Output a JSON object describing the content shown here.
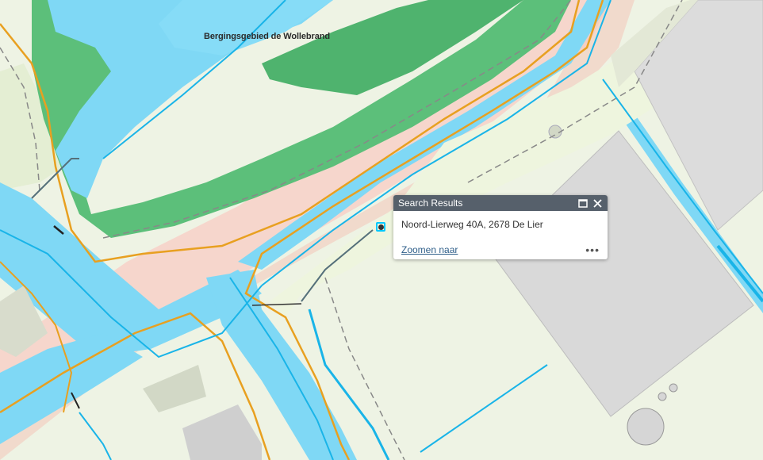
{
  "map": {
    "area_label": "Bergingsgebied de Wollebrand",
    "colors": {
      "water": "#7fd8f5",
      "water_line": "#19b4e8",
      "vegetation": "#5cbf7a",
      "road": "#f5d5cc",
      "road_edge": "#e8a020",
      "land": "#eef3e4",
      "building": "#dcdcdc"
    }
  },
  "popup": {
    "title": "Search Results",
    "address": "Noord-Lierweg 40A, 2678 De Lier",
    "zoom_link": "Zoomen naar",
    "more": "•••",
    "maximize_icon": "maximize-icon",
    "close_icon": "close-icon"
  }
}
